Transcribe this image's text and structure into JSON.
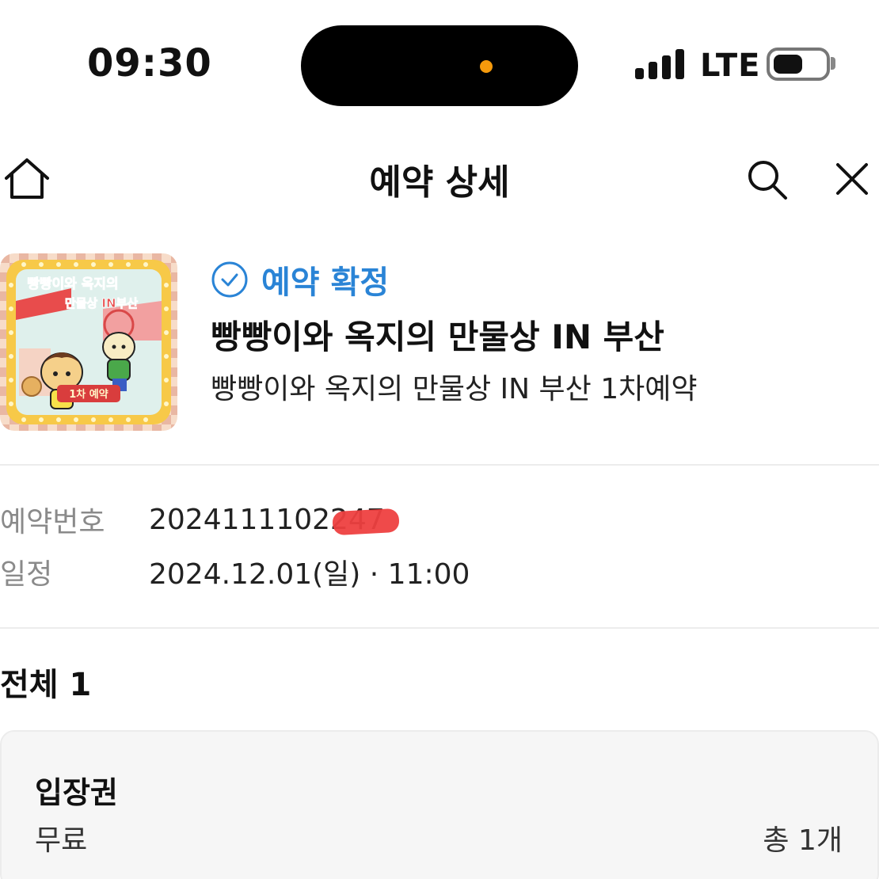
{
  "status_bar": {
    "time": "09:30",
    "network": "LTE",
    "signal_bars": 4,
    "battery_level": 0.5,
    "privacy_dot_color": "#f59a0c"
  },
  "header": {
    "title": "예약 상세",
    "icons": [
      "home-icon",
      "search-icon",
      "close-icon"
    ]
  },
  "product": {
    "status_label": "예약 확정",
    "status_color": "#2a84d6",
    "title": "빵빵이와 옥지의 만물상 IN 부산",
    "subtitle": "빵빵이와 옥지의 만물상 IN 부산 1차예약",
    "thumbnail": {
      "title_line1": "빵빵이와 옥지의",
      "title_line2": "만물상 IN부산",
      "badge": "1차 예약"
    }
  },
  "details": {
    "reservation_number_label": "예약번호",
    "reservation_number": "2024111102247",
    "schedule_label": "일정",
    "schedule": "2024.12.01(일) · 11:00"
  },
  "summary": {
    "total": "전체 1"
  },
  "ticket": {
    "name": "입장권",
    "price": "무료",
    "count": "총 1개"
  }
}
